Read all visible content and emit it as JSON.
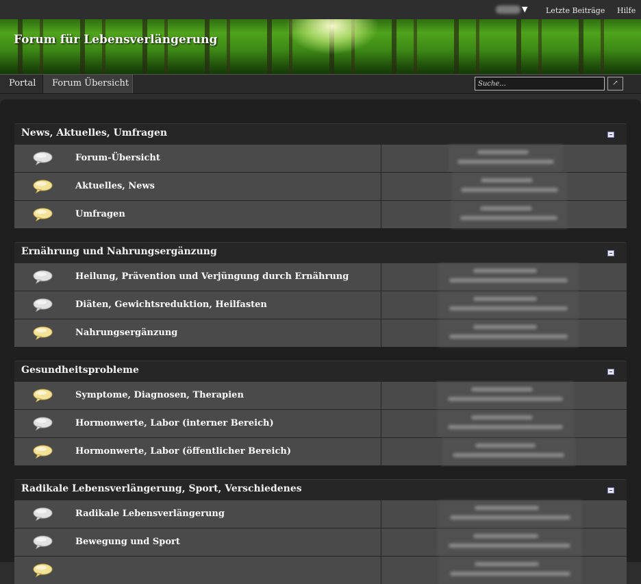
{
  "topbar": {
    "user_menu_arrow": "▼",
    "links": [
      "Letzte Beiträge",
      "Hilfe"
    ]
  },
  "banner": {
    "title": "Forum für Lebensverlängerung"
  },
  "nav": {
    "tabs": [
      "Portal",
      "Forum Übersicht"
    ],
    "active_tab": "Forum Übersicht",
    "search_placeholder": "Suche...",
    "search_button": "↗"
  },
  "categories": [
    {
      "title": "News, Aktuelles, Umfragen",
      "forums": [
        {
          "name": "Forum-Übersicht",
          "icon": "speech-bubble-grey-icon"
        },
        {
          "name": "Aktuelles, News",
          "icon": "speech-bubble-yellow-icon"
        },
        {
          "name": "Umfragen",
          "icon": "speech-bubble-yellow-icon"
        }
      ]
    },
    {
      "title": "Ernährung und Nahrungsergänzung",
      "forums": [
        {
          "name": "Heilung, Prävention und Verjüngung durch Ernährung",
          "icon": "speech-bubble-grey-icon"
        },
        {
          "name": "Diäten, Gewichtsreduktion, Heilfasten",
          "icon": "speech-bubble-grey-icon"
        },
        {
          "name": "Nahrungsergänzung",
          "icon": "speech-bubble-yellow-icon"
        }
      ]
    },
    {
      "title": "Gesundheitsprobleme",
      "forums": [
        {
          "name": "Symptome, Diagnosen, Therapien",
          "icon": "speech-bubble-yellow-icon"
        },
        {
          "name": "Hormonwerte, Labor (interner Bereich)",
          "icon": "speech-bubble-grey-icon"
        },
        {
          "name": "Hormonwerte, Labor (öffentlicher Bereich)",
          "icon": "speech-bubble-yellow-icon"
        }
      ]
    },
    {
      "title": "Radikale Lebensverlängerung, Sport, Verschiedenes",
      "forums": [
        {
          "name": "Radikale Lebensverlängerung",
          "icon": "speech-bubble-grey-icon"
        },
        {
          "name": "Bewegung und Sport",
          "icon": "speech-bubble-grey-icon"
        },
        {
          "name": "",
          "icon": "speech-bubble-yellow-icon"
        }
      ]
    }
  ],
  "colors": {
    "background": "#1f1f1f",
    "row": "#4a4a4a",
    "header": "#262626",
    "bubble_yellow": "#f3e39a",
    "bubble_grey": "#e2e2e2"
  }
}
